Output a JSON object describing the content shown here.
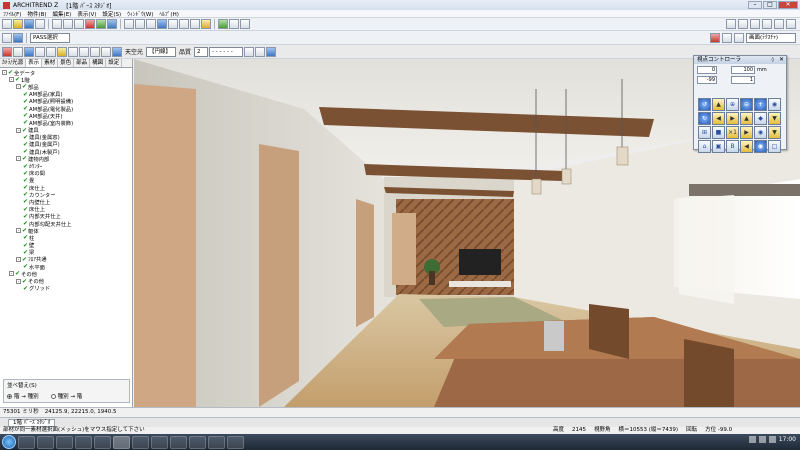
{
  "window": {
    "app_title": "ARCHITREND Z",
    "doc_title": "[1階 ﾊﾟｰｽ ｽﾀｼﾞｵ]"
  },
  "menu": [
    "ﾌｧｲﾙ(F)",
    "物件(B)",
    "編集(E)",
    "表示(V)",
    "設定(S)",
    "ｳｨﾝﾄﾞｳ(W)",
    "ﾍﾙﾌﾟ(H)"
  ],
  "toolbar": {
    "mode_combo": "PASS選択",
    "light_label": "天空光",
    "light_combo": "【円線】",
    "quality_label": "品質",
    "quality_value": "2",
    "dash_combo": "- - - - - -",
    "right_combo": "画面(ﾃｸｽﾁｬ)"
  },
  "left_panel": {
    "tabs": [
      "ｶﾒﾗ/光源",
      "表示",
      "素材",
      "景色",
      "部品",
      "構図",
      "設定"
    ],
    "active_tab": 1,
    "tree": [
      {
        "level": 0,
        "label": "全データ",
        "exp": "-"
      },
      {
        "level": 1,
        "label": "1階",
        "exp": "-"
      },
      {
        "level": 2,
        "label": "部品",
        "exp": "-"
      },
      {
        "level": 3,
        "label": "AM部品(家具)",
        "exp": ""
      },
      {
        "level": 3,
        "label": "AM部品(照明設備)",
        "exp": ""
      },
      {
        "level": 3,
        "label": "AM部品(電化製品)",
        "exp": ""
      },
      {
        "level": 3,
        "label": "AM部品(天井)",
        "exp": ""
      },
      {
        "level": 3,
        "label": "AM部品(室内装飾)",
        "exp": ""
      },
      {
        "level": 2,
        "label": "建具",
        "exp": "-"
      },
      {
        "level": 3,
        "label": "建具(金属窓)",
        "exp": ""
      },
      {
        "level": 3,
        "label": "建具(金属戸)",
        "exp": ""
      },
      {
        "level": 3,
        "label": "建具(木製戸)",
        "exp": ""
      },
      {
        "level": 2,
        "label": "建物内部",
        "exp": "-"
      },
      {
        "level": 3,
        "label": "ｶｳﾝﾀｰ",
        "exp": ""
      },
      {
        "level": 3,
        "label": "床の間",
        "exp": ""
      },
      {
        "level": 3,
        "label": "畳",
        "exp": ""
      },
      {
        "level": 3,
        "label": "床仕上",
        "exp": ""
      },
      {
        "level": 3,
        "label": "カウンター",
        "exp": ""
      },
      {
        "level": 3,
        "label": "内壁仕上",
        "exp": ""
      },
      {
        "level": 3,
        "label": "床仕上",
        "exp": ""
      },
      {
        "level": 3,
        "label": "内部天井仕上",
        "exp": ""
      },
      {
        "level": 3,
        "label": "内部勾配天井仕上",
        "exp": ""
      },
      {
        "level": 2,
        "label": "躯体",
        "exp": "-"
      },
      {
        "level": 3,
        "label": "柱",
        "exp": ""
      },
      {
        "level": 3,
        "label": "壁",
        "exp": ""
      },
      {
        "level": 3,
        "label": "梁",
        "exp": ""
      },
      {
        "level": 2,
        "label": "ﾌﾛｱ共通",
        "exp": "-"
      },
      {
        "level": 3,
        "label": "水平面",
        "exp": ""
      },
      {
        "level": 1,
        "label": "その他",
        "exp": "-"
      },
      {
        "level": 2,
        "label": "その他",
        "exp": "-"
      },
      {
        "level": 3,
        "label": "グリッド",
        "exp": ""
      }
    ],
    "sort": {
      "title": "並べ替え(S)",
      "option_a": "階 → 種別",
      "option_b": "種別 → 階",
      "selected": "a"
    }
  },
  "controller": {
    "title": "視点コントローラ",
    "field1": "0",
    "field2": "-99",
    "field3": "100",
    "field4": "1",
    "unit": "mm",
    "buttons": [
      "↺",
      "▲",
      "⊕",
      "⊖",
      "+",
      "◉",
      "↻",
      "◀",
      "▶",
      "▲",
      "◆",
      "▼",
      "⊞",
      "■",
      "×1",
      "▶",
      "◉",
      "▼",
      "⌂",
      "▣",
      "B",
      "◀",
      "◉",
      "□"
    ]
  },
  "status": {
    "coords_label": "75301 ミリ秒",
    "coords": "24125.9, 22215.0, 1940.5",
    "message": "部材が同一素材選択面(メッシュ)をマウス指定して下さい",
    "height_label": "高度",
    "height_value": "2145",
    "view_label": "視野角",
    "view_value": "横＝10553 (縦＝7439)",
    "azimuth_label": "回転",
    "azimuth_value": "方位 -99.0"
  },
  "tab": {
    "label": "1階 ﾊﾟｰｽ ｽﾀｼﾞｵ"
  },
  "taskbar": {
    "time": "17:00"
  }
}
